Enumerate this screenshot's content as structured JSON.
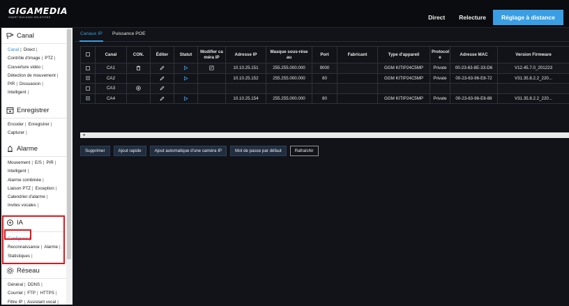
{
  "brand": {
    "name": "GIGAMEDIA",
    "tagline": "SMART BUILDING SOLUTIONS"
  },
  "topnav": [
    {
      "label": "Direct",
      "active": false
    },
    {
      "label": "Relecture",
      "active": false
    },
    {
      "label": "Réglage à distance",
      "active": true
    }
  ],
  "sidebar": {
    "canal": {
      "title": "Canal",
      "lines": [
        [
          "Canal",
          "Direct"
        ],
        [
          "Contrôle d'image",
          "PTZ"
        ],
        [
          "Couverture vidéo"
        ],
        [
          "Détection de mouvement"
        ],
        [
          "PIR",
          "Dissuasion"
        ],
        [
          "Intelligent"
        ]
      ],
      "active": "Canal"
    },
    "enregistrer": {
      "title": "Enregistrer",
      "lines": [
        [
          "Encoder",
          "Enregistrer"
        ],
        [
          "Capturer"
        ]
      ]
    },
    "alarme": {
      "title": "Alarme",
      "lines": [
        [
          "Mouvement",
          "E/S",
          "PIR"
        ],
        [
          "Intelligent"
        ],
        [
          "Alarme combinée"
        ],
        [
          "Liaison PTZ",
          "Exception"
        ],
        [
          "Calendrier d'alarme"
        ],
        [
          "Invites vocales"
        ]
      ]
    },
    "ia": {
      "title": "IA",
      "lines": [
        [
          "Configurer"
        ],
        [
          "Reconnaissance",
          "Alarme"
        ],
        [
          "Statistiques"
        ]
      ],
      "active": "Configurer"
    },
    "reseau": {
      "title": "Réseau",
      "lines": [
        [
          "Général",
          "DDNS"
        ],
        [
          "Courriel",
          "FTP",
          "HTTPS"
        ],
        [
          "Filtre IP",
          "Assistant vocal"
        ]
      ]
    }
  },
  "tabs": [
    {
      "label": "Canaux IP",
      "active": true
    },
    {
      "label": "Puissance POE",
      "active": false
    }
  ],
  "table": {
    "headers": [
      "",
      "Canal",
      "CON.",
      "Éditer",
      "Statut",
      "Modifier ca méra IP",
      "Adresse IP",
      "Masque sous-rése au",
      "Port",
      "Fabricant",
      "Type d'appareil",
      "Protocol e",
      "Adresse MAC",
      "Version Firmware"
    ],
    "rows": [
      {
        "canal": "CA1",
        "con": "trash",
        "edit": true,
        "status": "play",
        "modify": true,
        "ip": "10.10.25.151",
        "mask": "255.255.000.000",
        "port": "9000",
        "fabricant": "",
        "type": "GGM KITIP24C5MP",
        "protocol": "Private",
        "mac": "00-23-63-8E-33-D6",
        "firmware": "V12.45.7.0_201223"
      },
      {
        "canal": "CA2",
        "con": "",
        "edit": true,
        "status": "play",
        "modify": false,
        "ip": "10.10.25.152",
        "mask": "255.255.000.000",
        "port": "80",
        "fabricant": "",
        "type": "GGM KITIP24C5MP",
        "protocol": "Private",
        "mac": "00-23-63-96-E8-72",
        "firmware": "V31.35.8.2.2_220..."
      },
      {
        "canal": "CA3",
        "con": "add",
        "edit": true,
        "status": "",
        "modify": false,
        "ip": "",
        "mask": "",
        "port": "",
        "fabricant": "",
        "type": "",
        "protocol": "",
        "mac": "",
        "firmware": ""
      },
      {
        "canal": "CA4",
        "con": "",
        "edit": true,
        "status": "play",
        "modify": false,
        "ip": "10.10.25.154",
        "mask": "255.255.000.000",
        "port": "80",
        "fabricant": "",
        "type": "GGM KITIP24C5MP",
        "protocol": "Private",
        "mac": "00-23-63-96-E8-88",
        "firmware": "V31.35.8.2.2_220..."
      }
    ]
  },
  "buttons": [
    "Supprimer",
    "Ajout rapide",
    "Ajout automatique d'une caméra IP",
    "Mot de passe par défaut",
    "Rafraîchir"
  ],
  "colors": {
    "accent": "#3a9ee4",
    "highlight": "#e3141c",
    "background": "#111318"
  }
}
